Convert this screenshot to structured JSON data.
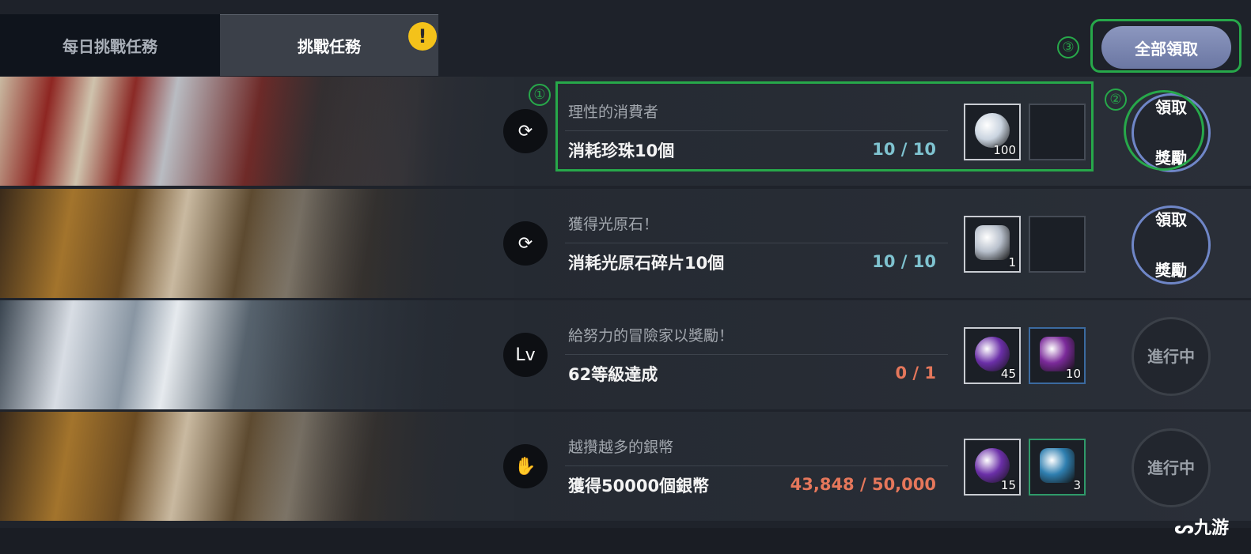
{
  "tabs": [
    {
      "label": "每日挑戰任務",
      "active": false
    },
    {
      "label": "挑戰任務",
      "active": true,
      "alert": "!"
    }
  ],
  "claim_all_label": "全部領取",
  "annotations": {
    "one": "①",
    "two": "②",
    "three": "③"
  },
  "quests": [
    {
      "type_icon": "refresh-icon",
      "type_glyph": "⟳",
      "title": "理性的消費者",
      "task": "消耗珍珠10個",
      "progress": "10 / 10",
      "complete": true,
      "rewards": [
        {
          "icon": "silver-coin-icon",
          "count": "100",
          "color": "#c9d3df"
        },
        {
          "icon": "empty",
          "count": ""
        }
      ],
      "status": "領取\n獎勵",
      "status_lines": [
        "領取",
        "獎勵"
      ],
      "claimable": true
    },
    {
      "type_icon": "refresh-icon",
      "type_glyph": "⟳",
      "title": "獲得光原石！",
      "task": "消耗光原石碎片10個",
      "progress": "10 / 10",
      "complete": true,
      "rewards": [
        {
          "icon": "crystal-shard-icon",
          "count": "1",
          "color": "#b8c0cc"
        },
        {
          "icon": "empty",
          "count": ""
        }
      ],
      "status_lines": [
        "領取",
        "獎勵"
      ],
      "claimable": true
    },
    {
      "type_icon": "level-icon",
      "type_glyph": "Lv",
      "title": "給努力的冒險家以獎勵！",
      "task": "62等級達成",
      "progress": "0 / 1",
      "complete": false,
      "rewards": [
        {
          "icon": "purple-orb-icon",
          "count": "45",
          "color": "#6b2fa8"
        },
        {
          "icon": "purple-gem-icon",
          "count": "10",
          "color": "#7b2a9a"
        }
      ],
      "status_lines": [
        "進行中"
      ],
      "claimable": false
    },
    {
      "type_icon": "hand-icon",
      "type_glyph": "✋",
      "title": "越攢越多的銀幣",
      "task": "獲得50000個銀幣",
      "progress": "43,848 / 50,000",
      "complete": false,
      "rewards": [
        {
          "icon": "purple-orb-icon",
          "count": "15",
          "color": "#6b2fa8"
        },
        {
          "icon": "blue-crystal-icon",
          "count": "3",
          "color": "#2f7fb0"
        }
      ],
      "status_lines": [
        "進行中"
      ],
      "claimable": false
    }
  ],
  "watermark": "九游"
}
